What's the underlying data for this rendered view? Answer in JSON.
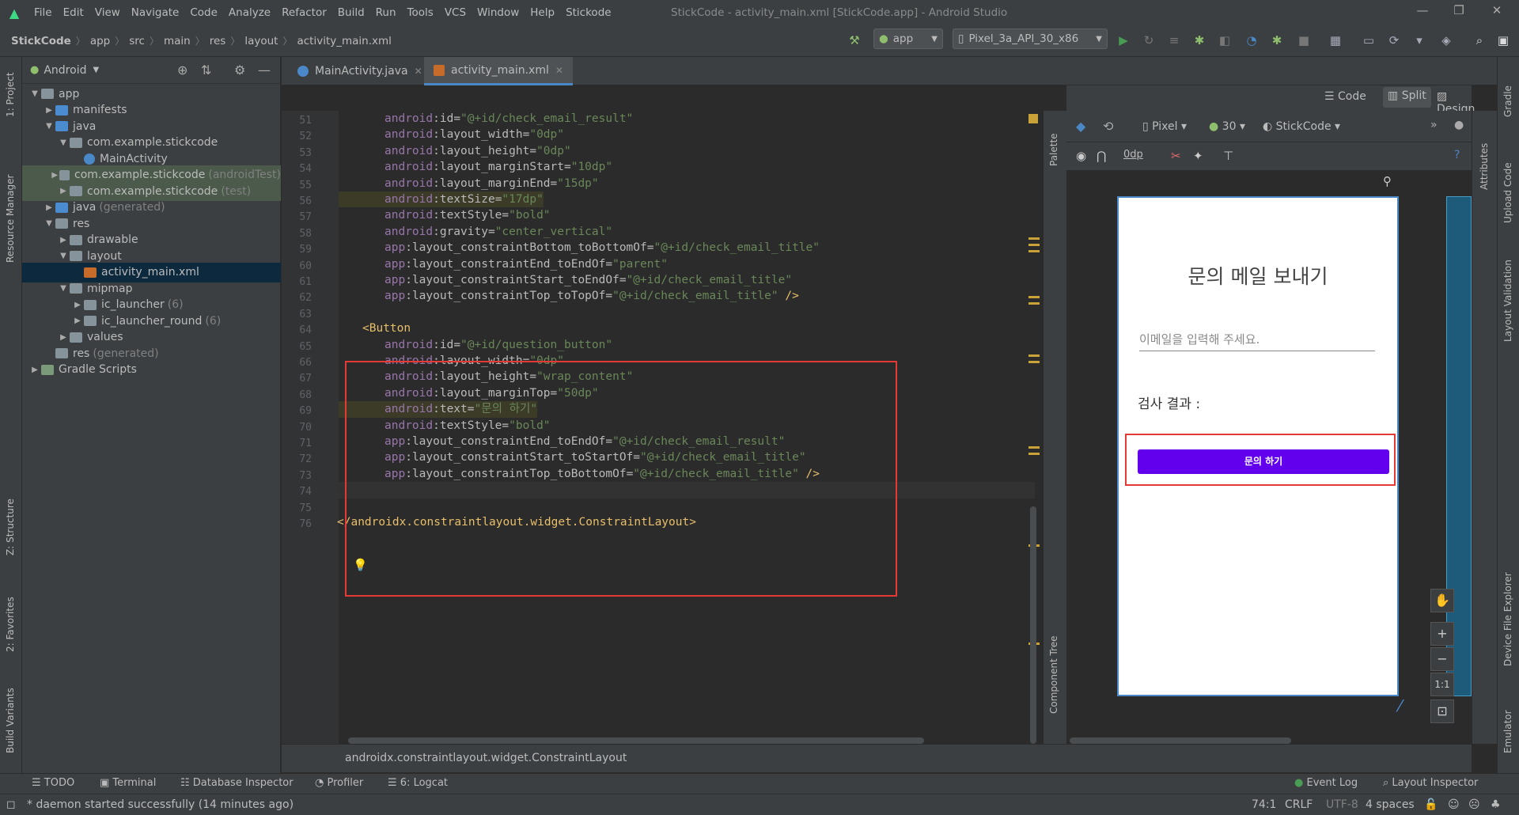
{
  "menu": [
    "File",
    "Edit",
    "View",
    "Navigate",
    "Code",
    "Analyze",
    "Refactor",
    "Build",
    "Run",
    "Tools",
    "VCS",
    "Window",
    "Help",
    "Stickode"
  ],
  "window_title": "StickCode - activity_main.xml [StickCode.app] - Android Studio",
  "breadcrumbs": [
    "StickCode",
    "app",
    "src",
    "main",
    "res",
    "layout",
    "activity_main.xml"
  ],
  "toolbar": {
    "run_config": "app",
    "device": "Pixel_3a_API_30_x86"
  },
  "left_strip": [
    "1: Project",
    "Resource Manager",
    "Z: Structure",
    "2: Favorites",
    "Build Variants"
  ],
  "project": {
    "view": "Android",
    "tree": [
      {
        "label": "app",
        "extra": "",
        "depth": 0,
        "arrow": "▼",
        "icon": "folder",
        "cls": ""
      },
      {
        "label": "manifests",
        "extra": "",
        "depth": 1,
        "arrow": "▶",
        "icon": "folder-blue",
        "cls": ""
      },
      {
        "label": "java",
        "extra": "",
        "depth": 1,
        "arrow": "▼",
        "icon": "folder-blue",
        "cls": ""
      },
      {
        "label": "com.example.stickcode",
        "extra": "",
        "depth": 2,
        "arrow": "▼",
        "icon": "folder",
        "cls": ""
      },
      {
        "label": "MainActivity",
        "extra": "",
        "depth": 3,
        "arrow": "",
        "icon": "class",
        "cls": ""
      },
      {
        "label": "com.example.stickcode",
        "extra": "(androidTest)",
        "depth": 2,
        "arrow": "▶",
        "icon": "folder",
        "cls": "hl"
      },
      {
        "label": "com.example.stickcode",
        "extra": "(test)",
        "depth": 2,
        "arrow": "▶",
        "icon": "folder",
        "cls": "hl"
      },
      {
        "label": "java",
        "extra": "(generated)",
        "depth": 1,
        "arrow": "▶",
        "icon": "folder-blue",
        "cls": ""
      },
      {
        "label": "res",
        "extra": "",
        "depth": 1,
        "arrow": "▼",
        "icon": "folder",
        "cls": ""
      },
      {
        "label": "drawable",
        "extra": "",
        "depth": 2,
        "arrow": "▶",
        "icon": "folder",
        "cls": ""
      },
      {
        "label": "layout",
        "extra": "",
        "depth": 2,
        "arrow": "▼",
        "icon": "folder",
        "cls": ""
      },
      {
        "label": "activity_main.xml",
        "extra": "",
        "depth": 3,
        "arrow": "",
        "icon": "xml",
        "cls": "sel"
      },
      {
        "label": "mipmap",
        "extra": "",
        "depth": 2,
        "arrow": "▼",
        "icon": "folder",
        "cls": ""
      },
      {
        "label": "ic_launcher",
        "extra": "(6)",
        "depth": 3,
        "arrow": "▶",
        "icon": "folder",
        "cls": ""
      },
      {
        "label": "ic_launcher_round",
        "extra": "(6)",
        "depth": 3,
        "arrow": "▶",
        "icon": "folder",
        "cls": ""
      },
      {
        "label": "values",
        "extra": "",
        "depth": 2,
        "arrow": "▶",
        "icon": "folder",
        "cls": ""
      },
      {
        "label": "res",
        "extra": "(generated)",
        "depth": 1,
        "arrow": "",
        "icon": "folder",
        "cls": ""
      },
      {
        "label": "Gradle Scripts",
        "extra": "",
        "depth": 0,
        "arrow": "▶",
        "icon": "gradle",
        "cls": ""
      }
    ]
  },
  "tabs": [
    {
      "label": "MainActivity.java",
      "active": false
    },
    {
      "label": "activity_main.xml",
      "active": true
    }
  ],
  "view_modes": [
    "Code",
    "Split",
    "Design"
  ],
  "code_lines": [
    {
      "n": "51",
      "text": "android:id=\"@+id/check_email_result\""
    },
    {
      "n": "52",
      "text": "android:layout_width=\"0dp\""
    },
    {
      "n": "53",
      "text": "android:layout_height=\"0dp\""
    },
    {
      "n": "54",
      "text": "android:layout_marginStart=\"10dp\""
    },
    {
      "n": "55",
      "text": "android:layout_marginEnd=\"15dp\""
    },
    {
      "n": "56",
      "text": "android:textSize=\"17dp\"",
      "hl": true
    },
    {
      "n": "57",
      "text": "android:textStyle=\"bold\""
    },
    {
      "n": "58",
      "text": "android:gravity=\"center_vertical\""
    },
    {
      "n": "59",
      "text": "app:layout_constraintBottom_toBottomOf=\"@+id/check_email_title\""
    },
    {
      "n": "60",
      "text": "app:layout_constraintEnd_toEndOf=\"parent\""
    },
    {
      "n": "61",
      "text": "app:layout_constraintStart_toEndOf=\"@+id/check_email_title\""
    },
    {
      "n": "62",
      "text": "app:layout_constraintTop_toTopOf=\"@+id/check_email_title\" />"
    },
    {
      "n": "63",
      "text": ""
    },
    {
      "n": "64",
      "text": "<Button",
      "tag": true
    },
    {
      "n": "65",
      "text": "android:id=\"@+id/question_button\""
    },
    {
      "n": "66",
      "text": "android:layout_width=\"0dp\""
    },
    {
      "n": "67",
      "text": "android:layout_height=\"wrap_content\""
    },
    {
      "n": "68",
      "text": "android:layout_marginTop=\"50dp\""
    },
    {
      "n": "69",
      "text": "android:text=\"문의 하기\"",
      "hl": true
    },
    {
      "n": "70",
      "text": "android:textStyle=\"bold\""
    },
    {
      "n": "71",
      "text": "app:layout_constraintEnd_toEndOf=\"@+id/check_email_result\""
    },
    {
      "n": "72",
      "text": "app:layout_constraintStart_toStartOf=\"@+id/check_email_title\""
    },
    {
      "n": "73",
      "text": "app:layout_constraintTop_toBottomOf=\"@+id/check_email_title\" />"
    },
    {
      "n": "74",
      "text": "",
      "cur": true
    },
    {
      "n": "75",
      "text": ""
    },
    {
      "n": "76",
      "text": "</androidx.constraintlayout.widget.ConstraintLayout>",
      "tag": true,
      "outdent": true
    }
  ],
  "design_toolbar": {
    "device": "Pixel",
    "api": "30",
    "theme": "StickCode",
    "margin": "0dp"
  },
  "preview": {
    "title": "문의 메일 보내기",
    "input_placeholder": "이메일을 입력해 주세요.",
    "result_label": "검사 결과 :",
    "button_label": "문의 하기"
  },
  "zoom_controls": [
    "+",
    "−",
    "1:1"
  ],
  "side_labels": {
    "palette": "Palette",
    "component_tree": "Component Tree",
    "attributes": "Attributes"
  },
  "right_strip": [
    "Gradle",
    "Upload Code",
    "Layout Validation",
    "Device File Explorer",
    "Emulator"
  ],
  "xml_breadcrumb": "androidx.constraintlayout.widget.ConstraintLayout",
  "bottom_tools": [
    "TODO",
    "Terminal",
    "Database Inspector",
    "Profiler",
    "6: Logcat"
  ],
  "bottom_right_tools": [
    "Event Log",
    "Layout Inspector"
  ],
  "status": {
    "message": "* daemon started successfully (14 minutes ago)",
    "position": "74:1",
    "line_sep": "CRLF",
    "encoding": "UTF-8",
    "indent": "4 spaces"
  },
  "colors": {
    "accent_button": "#6200ee",
    "highlight_box": "#e53935",
    "run_green": "#499c54"
  }
}
